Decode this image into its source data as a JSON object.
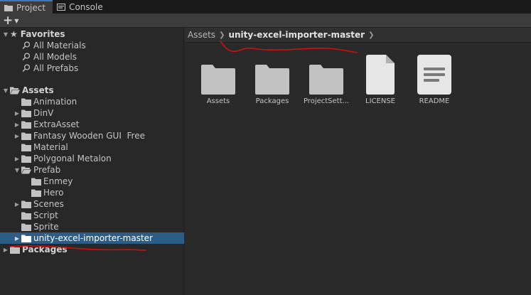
{
  "tabs": [
    {
      "label": "Project",
      "icon": "folder-icon",
      "active": true
    },
    {
      "label": "Console",
      "icon": "console-icon",
      "active": false
    }
  ],
  "toolbar": {
    "add_label": "+",
    "add_icon": "plus-icon"
  },
  "tree": {
    "favorites": {
      "label": "Favorites",
      "items": [
        "All Materials",
        "All Models",
        "All Prefabs"
      ]
    },
    "assets": {
      "label": "Assets",
      "items": [
        "Animation",
        "DinV",
        "ExtraAsset",
        "Fantasy Wooden GUI  Free",
        "Material",
        "Polygonal Metalon",
        "Prefab",
        "Enmey",
        "Hero",
        "Scenes",
        "Script",
        "Sprite",
        "unity-excel-importer-master"
      ]
    },
    "packages": {
      "label": "Packages"
    }
  },
  "breadcrumb": {
    "root": "Assets",
    "current": "unity-excel-importer-master"
  },
  "grid": [
    {
      "label": "Assets",
      "type": "folder"
    },
    {
      "label": "Packages",
      "type": "folder"
    },
    {
      "label": "ProjectSett...",
      "type": "folder"
    },
    {
      "label": "LICENSE",
      "type": "file"
    },
    {
      "label": "README",
      "type": "text-file"
    }
  ],
  "colors": {
    "selection": "#2c5d87",
    "annotation": "#d01010",
    "folder": "#c2c2c2"
  }
}
